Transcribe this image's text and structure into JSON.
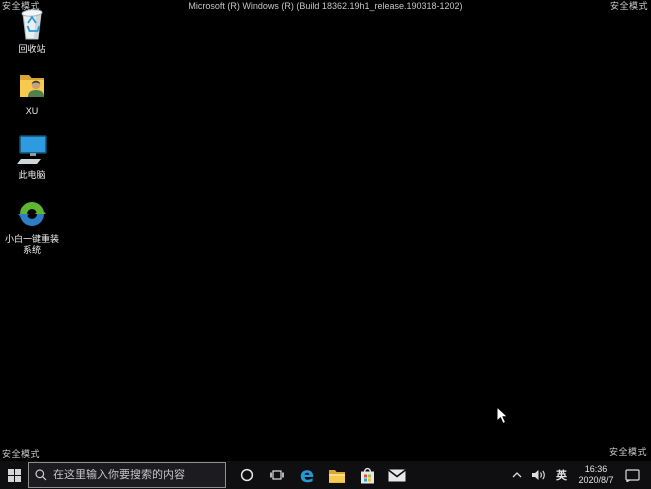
{
  "system": {
    "safe_mode": "安全模式",
    "build_banner": "Microsoft (R) Windows (R) (Build 18362.19h1_release.190318-1202)"
  },
  "desktop": {
    "icons": [
      {
        "name": "recycle-bin",
        "label": "回收站"
      },
      {
        "name": "user-folder",
        "label": "XU"
      },
      {
        "name": "this-pc",
        "label": "此电脑"
      },
      {
        "name": "xiaobai-reinstall",
        "label": "小白一键重装",
        "label2": "系统"
      }
    ]
  },
  "taskbar": {
    "search": {
      "placeholder": "在这里输入你要搜索的内容"
    },
    "tray": {
      "ime": "英",
      "time": "16:36",
      "date": "2020/8/7"
    }
  },
  "colors": {
    "taskbar_bg": "#0f0f12",
    "edge_blue": "#2599d6",
    "folder_yellow": "#f6c94f",
    "monitor_blue": "#2e9be0",
    "xiaobai_green": "#5fb632",
    "xiaobai_blue": "#2e7cc4",
    "recycle_blue": "#2e9bd6"
  }
}
